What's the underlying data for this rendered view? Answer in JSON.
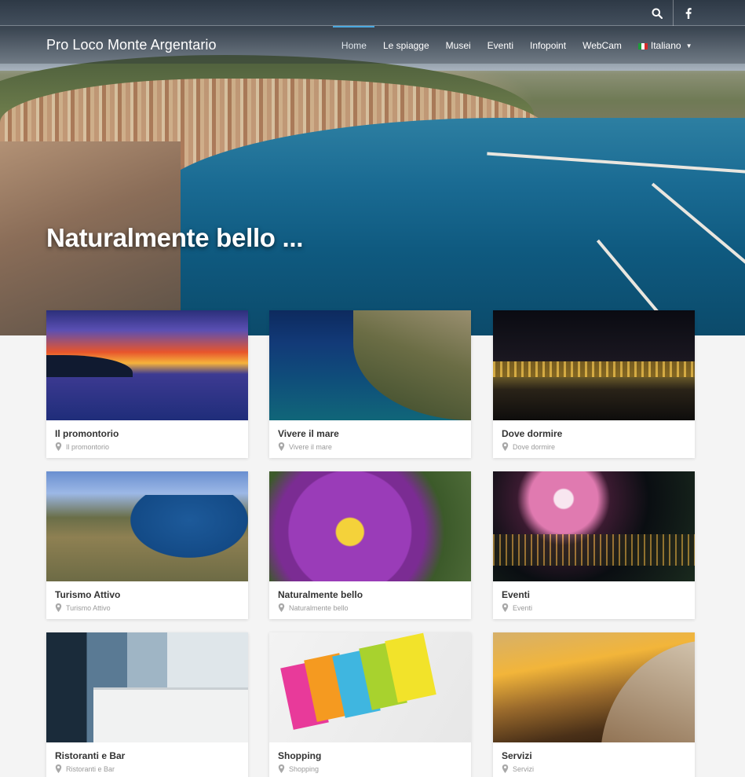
{
  "site": {
    "brand": "Pro Loco Monte Argentario",
    "tagline": "Naturalmente bello ..."
  },
  "topbar": {
    "icons": [
      "search-icon",
      "facebook-icon"
    ]
  },
  "nav": {
    "items": [
      {
        "label": "Home",
        "active": true
      },
      {
        "label": "Le spiagge"
      },
      {
        "label": "Musei"
      },
      {
        "label": "Eventi"
      },
      {
        "label": "Infopoint"
      },
      {
        "label": "WebCam"
      }
    ],
    "language": "Italiano"
  },
  "cards": [
    {
      "title": "Il promontorio",
      "location": "Il promontorio"
    },
    {
      "title": "Vivere il mare",
      "location": "Vivere il mare"
    },
    {
      "title": "Dove dormire",
      "location": "Dove dormire"
    },
    {
      "title": "Turismo Attivo",
      "location": "Turismo Attivo"
    },
    {
      "title": "Naturalmente bello",
      "location": "Naturalmente bello"
    },
    {
      "title": "Eventi",
      "location": "Eventi"
    },
    {
      "title": "Ristoranti e Bar",
      "location": "Ristoranti e Bar"
    },
    {
      "title": "Shopping",
      "location": "Shopping"
    },
    {
      "title": "Servizi",
      "location": "Servizi"
    }
  ],
  "colors": {
    "nav_active_accent": "#4aa8e0",
    "card_title": "#333333",
    "card_location": "#9a9a9a",
    "page_background": "#f4f4f4"
  }
}
